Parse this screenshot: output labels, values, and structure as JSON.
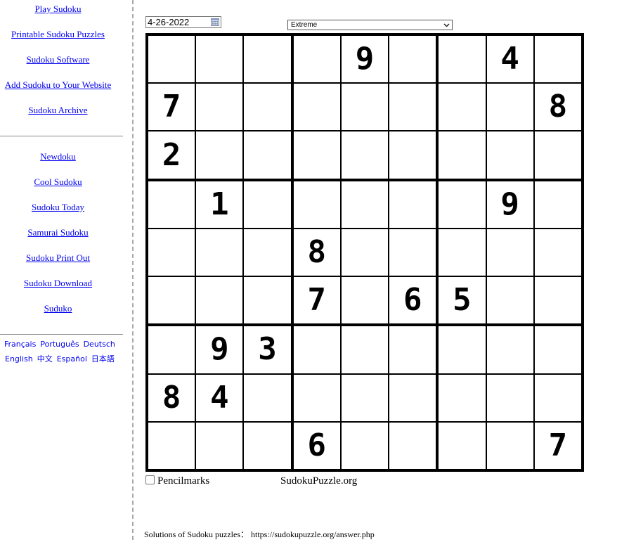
{
  "sidebar": {
    "links_top": [
      "Play Sudoku",
      "Printable Sudoku Puzzles",
      "Sudoku Software",
      "Add Sudoku to Your Website",
      "Sudoku Archive"
    ],
    "links_mid": [
      "Newdoku",
      "Cool Sudoku",
      "Sudoku Today",
      "Samurai Sudoku",
      "Sudoku Print Out",
      "Sudoku Download",
      "Suduko"
    ],
    "languages_row1": [
      "Français",
      "Português",
      "Deutsch"
    ],
    "languages_row2": [
      "English",
      "中文",
      "Español",
      "日本語"
    ]
  },
  "controls": {
    "date": "4-26-2022",
    "level": "Extreme"
  },
  "grid": [
    [
      "",
      "",
      "",
      "",
      "9",
      "",
      "",
      "4",
      ""
    ],
    [
      "7",
      "",
      "",
      "",
      "",
      "",
      "",
      "",
      "8"
    ],
    [
      "2",
      "",
      "",
      "",
      "",
      "",
      "",
      "",
      ""
    ],
    [
      "",
      "1",
      "",
      "",
      "",
      "",
      "",
      "9",
      ""
    ],
    [
      "",
      "",
      "",
      "8",
      "",
      "",
      "",
      "",
      ""
    ],
    [
      "",
      "",
      "",
      "7",
      "",
      "6",
      "5",
      "",
      ""
    ],
    [
      "",
      "9",
      "3",
      "",
      "",
      "",
      "",
      "",
      ""
    ],
    [
      "8",
      "4",
      "",
      "",
      "",
      "",
      "",
      "",
      ""
    ],
    [
      "",
      "",
      "",
      "6",
      "",
      "",
      "",
      "",
      "7"
    ]
  ],
  "pencilmarks": {
    "label": "Pencilmarks",
    "checked": false
  },
  "site_name": "SudokuPuzzle.org",
  "footer": "Solutions of Sudoku puzzles： https://sudokupuzzle.org/answer.php"
}
